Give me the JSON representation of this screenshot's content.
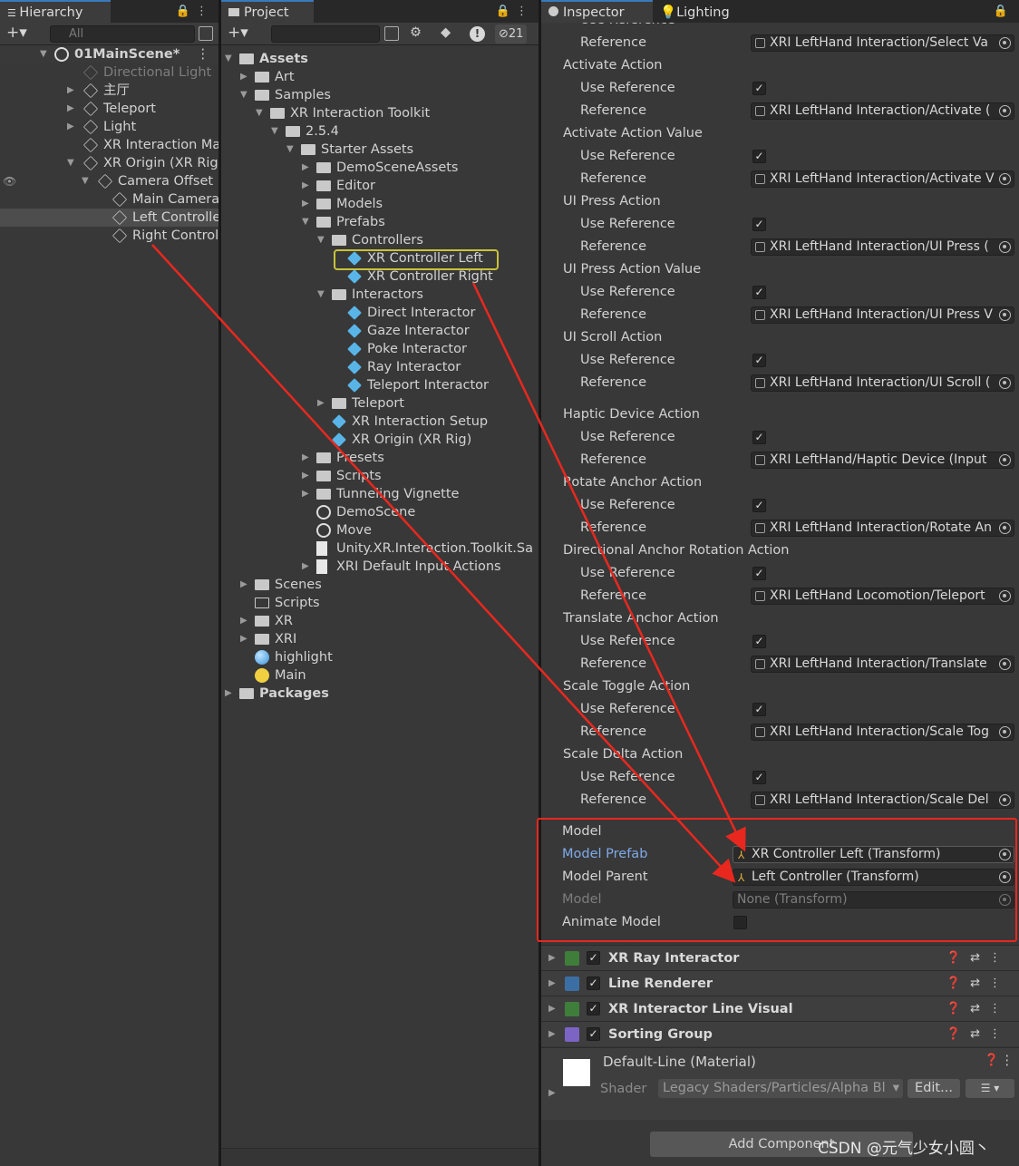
{
  "hierarchy": {
    "tab": "Hierarchy",
    "search_placeholder": "All",
    "scene": "01MainScene*",
    "items": [
      {
        "label": "Directional Light",
        "depth": 1,
        "tri": "",
        "dim": true
      },
      {
        "label": "主厅",
        "depth": 1,
        "tri": "▶"
      },
      {
        "label": "Teleport",
        "depth": 1,
        "tri": "▶"
      },
      {
        "label": "Light",
        "depth": 1,
        "tri": "▶"
      },
      {
        "label": "XR Interaction Mana",
        "depth": 1,
        "tri": ""
      },
      {
        "label": "XR Origin (XR Rig)",
        "depth": 1,
        "tri": "▼"
      },
      {
        "label": "Camera Offset",
        "depth": 2,
        "tri": "▼"
      },
      {
        "label": "Main Camera",
        "depth": 3,
        "tri": ""
      },
      {
        "label": "Left Controller",
        "depth": 3,
        "tri": "",
        "selected": true
      },
      {
        "label": "Right Controlle",
        "depth": 3,
        "tri": ""
      }
    ]
  },
  "project": {
    "tab": "Project",
    "hidden_count": "21",
    "items": [
      {
        "label": "Assets",
        "depth": 0,
        "tri": "▼",
        "icon": "folder",
        "bold": true
      },
      {
        "label": "Art",
        "depth": 1,
        "tri": "▶",
        "icon": "folder"
      },
      {
        "label": "Samples",
        "depth": 1,
        "tri": "▼",
        "icon": "folder"
      },
      {
        "label": "XR Interaction Toolkit",
        "depth": 2,
        "tri": "▼",
        "icon": "folder"
      },
      {
        "label": "2.5.4",
        "depth": 3,
        "tri": "▼",
        "icon": "folder"
      },
      {
        "label": "Starter Assets",
        "depth": 4,
        "tri": "▼",
        "icon": "folder"
      },
      {
        "label": "DemoSceneAssets",
        "depth": 5,
        "tri": "▶",
        "icon": "folder"
      },
      {
        "label": "Editor",
        "depth": 5,
        "tri": "▶",
        "icon": "folder"
      },
      {
        "label": "Models",
        "depth": 5,
        "tri": "▶",
        "icon": "folder"
      },
      {
        "label": "Prefabs",
        "depth": 5,
        "tri": "▼",
        "icon": "folder"
      },
      {
        "label": "Controllers",
        "depth": 6,
        "tri": "▼",
        "icon": "folder"
      },
      {
        "label": "XR Controller Left",
        "depth": 7,
        "tri": "",
        "icon": "prefab"
      },
      {
        "label": "XR Controller Right",
        "depth": 7,
        "tri": "",
        "icon": "prefab"
      },
      {
        "label": "Interactors",
        "depth": 6,
        "tri": "▼",
        "icon": "folder"
      },
      {
        "label": "Direct Interactor",
        "depth": 7,
        "tri": "",
        "icon": "prefab"
      },
      {
        "label": "Gaze Interactor",
        "depth": 7,
        "tri": "",
        "icon": "prefab"
      },
      {
        "label": "Poke Interactor",
        "depth": 7,
        "tri": "",
        "icon": "prefab"
      },
      {
        "label": "Ray Interactor",
        "depth": 7,
        "tri": "",
        "icon": "prefab"
      },
      {
        "label": "Teleport Interactor",
        "depth": 7,
        "tri": "",
        "icon": "prefab"
      },
      {
        "label": "Teleport",
        "depth": 6,
        "tri": "▶",
        "icon": "folder"
      },
      {
        "label": "XR Interaction Setup",
        "depth": 6,
        "tri": "",
        "icon": "prefab"
      },
      {
        "label": "XR Origin (XR Rig)",
        "depth": 6,
        "tri": "",
        "icon": "prefab"
      },
      {
        "label": "Presets",
        "depth": 5,
        "tri": "▶",
        "icon": "folder"
      },
      {
        "label": "Scripts",
        "depth": 5,
        "tri": "▶",
        "icon": "folder"
      },
      {
        "label": "Tunneling Vignette",
        "depth": 5,
        "tri": "▶",
        "icon": "folder"
      },
      {
        "label": "DemoScene",
        "depth": 5,
        "tri": "",
        "icon": "scene"
      },
      {
        "label": "Move",
        "depth": 5,
        "tri": "",
        "icon": "scene"
      },
      {
        "label": "Unity.XR.Interaction.Toolkit.Sa",
        "depth": 5,
        "tri": "",
        "icon": "file"
      },
      {
        "label": "XRI Default Input Actions",
        "depth": 5,
        "tri": "▶",
        "icon": "file"
      },
      {
        "label": "Scenes",
        "depth": 1,
        "tri": "▶",
        "icon": "folder"
      },
      {
        "label": "Scripts",
        "depth": 1,
        "tri": "",
        "icon": "folder-empty"
      },
      {
        "label": "XR",
        "depth": 1,
        "tri": "▶",
        "icon": "folder"
      },
      {
        "label": "XRI",
        "depth": 1,
        "tri": "▶",
        "icon": "folder"
      },
      {
        "label": "highlight",
        "depth": 1,
        "tri": "",
        "icon": "material"
      },
      {
        "label": "Main",
        "depth": 1,
        "tri": "",
        "icon": "light"
      },
      {
        "label": "Packages",
        "depth": 0,
        "tri": "▶",
        "icon": "folder",
        "bold": true
      }
    ]
  },
  "inspector": {
    "tab_inspector": "Inspector",
    "tab_lighting": "Lighting",
    "rows": [
      {
        "kind": "sub",
        "label": "Use Reference",
        "clipped": true
      },
      {
        "kind": "ref",
        "label": "Reference",
        "value": "XRI LeftHand Interaction/Select Va"
      },
      {
        "kind": "head",
        "label": "Activate Action"
      },
      {
        "kind": "chk",
        "label": "Use Reference"
      },
      {
        "kind": "ref",
        "label": "Reference",
        "value": "XRI LeftHand Interaction/Activate ("
      },
      {
        "kind": "head",
        "label": "Activate Action Value"
      },
      {
        "kind": "chk",
        "label": "Use Reference"
      },
      {
        "kind": "ref",
        "label": "Reference",
        "value": "XRI LeftHand Interaction/Activate V"
      },
      {
        "kind": "head",
        "label": "UI Press Action"
      },
      {
        "kind": "chk",
        "label": "Use Reference"
      },
      {
        "kind": "ref",
        "label": "Reference",
        "value": "XRI LeftHand Interaction/UI Press ("
      },
      {
        "kind": "head",
        "label": "UI Press Action Value"
      },
      {
        "kind": "chk",
        "label": "Use Reference"
      },
      {
        "kind": "ref",
        "label": "Reference",
        "value": "XRI LeftHand Interaction/UI Press V"
      },
      {
        "kind": "head",
        "label": "UI Scroll Action"
      },
      {
        "kind": "chk",
        "label": "Use Reference"
      },
      {
        "kind": "ref",
        "label": "Reference",
        "value": "XRI LeftHand Interaction/UI Scroll ("
      },
      {
        "kind": "gap"
      },
      {
        "kind": "head",
        "label": "Haptic Device Action"
      },
      {
        "kind": "chk",
        "label": "Use Reference"
      },
      {
        "kind": "ref",
        "label": "Reference",
        "value": "XRI LeftHand/Haptic Device (Input"
      },
      {
        "kind": "head",
        "label": "Rotate Anchor Action"
      },
      {
        "kind": "chk",
        "label": "Use Reference"
      },
      {
        "kind": "ref",
        "label": "Reference",
        "value": "XRI LeftHand Interaction/Rotate An"
      },
      {
        "kind": "head",
        "label": "Directional Anchor Rotation Action"
      },
      {
        "kind": "chk",
        "label": "Use Reference"
      },
      {
        "kind": "ref",
        "label": "Reference",
        "value": "XRI LeftHand Locomotion/Teleport"
      },
      {
        "kind": "head",
        "label": "Translate Anchor Action"
      },
      {
        "kind": "chk",
        "label": "Use Reference"
      },
      {
        "kind": "ref",
        "label": "Reference",
        "value": "XRI LeftHand Interaction/Translate"
      },
      {
        "kind": "head",
        "label": "Scale Toggle Action"
      },
      {
        "kind": "chk",
        "label": "Use Reference"
      },
      {
        "kind": "ref",
        "label": "Reference",
        "value": "XRI LeftHand Interaction/Scale Tog"
      },
      {
        "kind": "head",
        "label": "Scale Delta Action"
      },
      {
        "kind": "chk",
        "label": "Use Reference"
      },
      {
        "kind": "ref",
        "label": "Reference",
        "value": "XRI LeftHand Interaction/Scale Del"
      }
    ],
    "model": {
      "header": "Model",
      "prefab_label": "Model Prefab",
      "prefab_value": "XR Controller Left (Transform)",
      "parent_label": "Model Parent",
      "parent_value": "Left Controller (Transform)",
      "model_label": "Model",
      "model_value": "None (Transform)",
      "animate_label": "Animate Model"
    },
    "components": [
      {
        "name": "XR Ray Interactor",
        "icon_color": "#3f7d3a"
      },
      {
        "name": "Line Renderer",
        "icon_color": "#3b6fa3"
      },
      {
        "name": "XR Interactor Line Visual",
        "icon_color": "#3f7d3a"
      },
      {
        "name": "Sorting Group",
        "icon_color": "#7b64c4"
      }
    ],
    "material": {
      "name": "Default-Line (Material)",
      "shader_label": "Shader",
      "shader_value": "Legacy Shaders/Particles/Alpha Bl",
      "edit": "Edit..."
    },
    "add_component": "Add Component"
  },
  "watermark": "CSDN @元气少女小圆丶",
  "colors": {
    "annotation": "#e8281f",
    "highlight": "#c9c23a",
    "link": "#7fa9e8"
  }
}
